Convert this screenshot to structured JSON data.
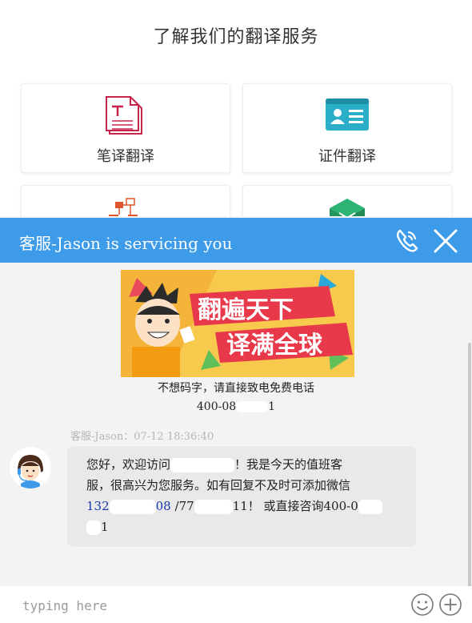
{
  "page": {
    "title": "了解我们的翻译服务",
    "cards": [
      {
        "label": "笔译翻译",
        "icon": "document-translate-icon"
      },
      {
        "label": "证件翻译",
        "icon": "id-card-icon"
      },
      {
        "label": "",
        "icon": "org-chart-icon"
      },
      {
        "label": "",
        "icon": "green-box-icon"
      }
    ]
  },
  "chat": {
    "header_title": "客服-Jason is servicing you",
    "accent_color": "#3d9bea",
    "banner": {
      "line1": "翻遍天下",
      "line2": "译满全球"
    },
    "notice": {
      "line1": "不想码字，请直接致电免费电话",
      "phone_start": "400-08",
      "phone_end": "1"
    },
    "message": {
      "meta": "客服-Jason：07-12 18:36:40",
      "text_1a": "您好，欢迎访问",
      "text_1b": "！我是今天的值班客",
      "text_2": "服，很高兴为您服务。如有回复不及时可添加微信",
      "num_1": "132",
      "num_2": "08",
      "text_3a": "/77",
      "text_3b": "11！ 或直接咨询400-0",
      "text_4": "1"
    },
    "input_placeholder": "typing here"
  }
}
